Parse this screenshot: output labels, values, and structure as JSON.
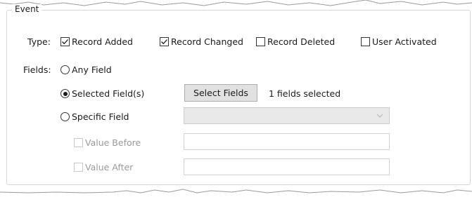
{
  "event_group": {
    "title": "Event",
    "type": {
      "label": "Type:",
      "options": [
        {
          "label": "Record Added",
          "checked": true
        },
        {
          "label": "Record Changed",
          "checked": true
        },
        {
          "label": "Record Deleted",
          "checked": false
        },
        {
          "label": "User Activated",
          "checked": false
        }
      ]
    },
    "fields": {
      "label": "Fields:",
      "radios": [
        {
          "label": "Any Field",
          "selected": false
        },
        {
          "label": "Selected Field(s)",
          "selected": true
        },
        {
          "label": "Specific Field",
          "selected": false
        }
      ],
      "select_fields_button": "Select Fields",
      "selection_status": "1 fields selected",
      "specific_field_combo": {
        "value": "",
        "enabled": false
      },
      "value_before": {
        "label": "Value Before",
        "checked": false,
        "enabled": false,
        "value": ""
      },
      "value_after": {
        "label": "Value After",
        "checked": false,
        "enabled": false,
        "value": ""
      }
    }
  },
  "icons": {
    "check": "check-icon",
    "dropdown": "chevron-down-icon"
  }
}
